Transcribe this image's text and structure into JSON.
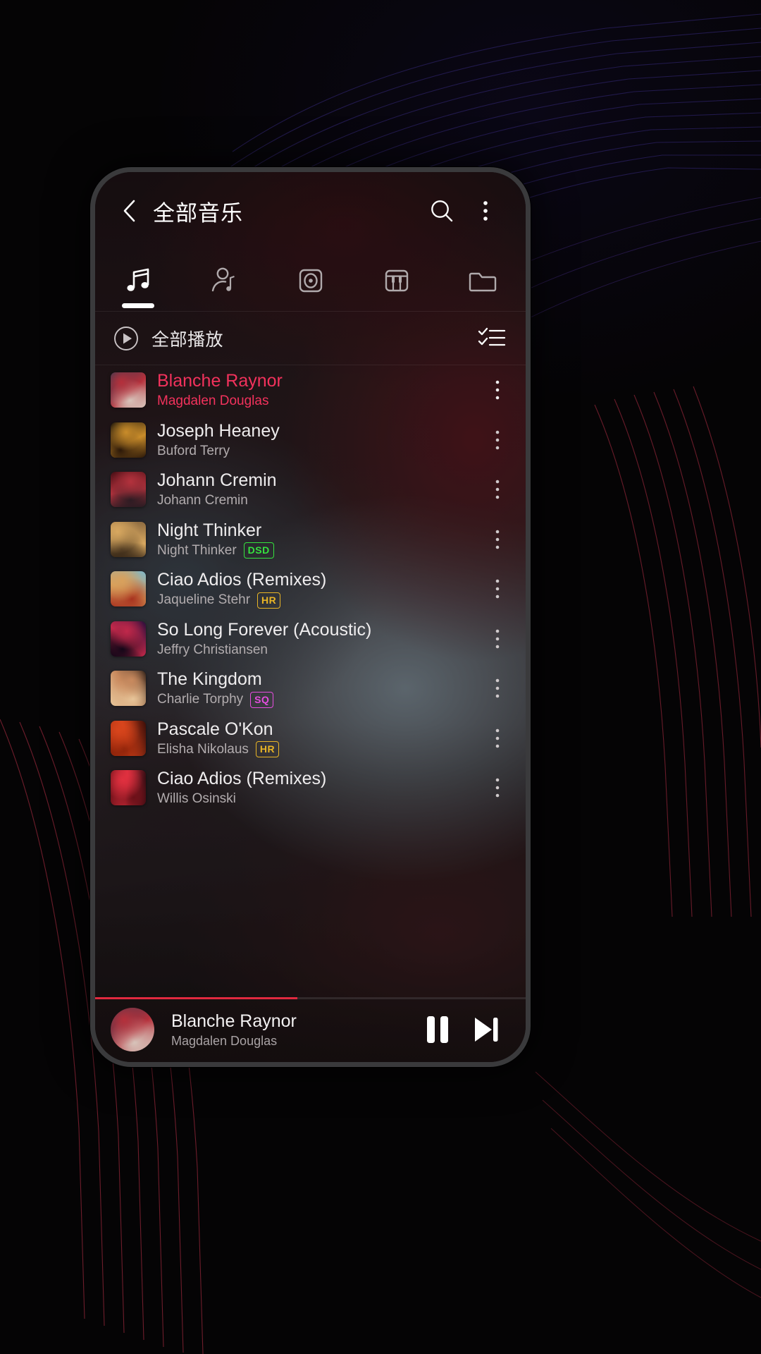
{
  "app": {
    "header": {
      "back_icon": "chevron-left-icon",
      "title": "全部音乐",
      "search_icon": "search-icon",
      "more_icon": "more-vertical-icon"
    },
    "tabs": [
      {
        "name": "songs",
        "icon": "music-note-icon",
        "active": true
      },
      {
        "name": "artists",
        "icon": "artist-icon",
        "active": false
      },
      {
        "name": "albums",
        "icon": "album-disc-icon",
        "active": false
      },
      {
        "name": "genres",
        "icon": "piano-keys-icon",
        "active": false
      },
      {
        "name": "folders",
        "icon": "folder-icon",
        "active": false
      }
    ],
    "play_all": {
      "icon": "play-circle-icon",
      "label": "全部播放",
      "list_icon": "checklist-icon"
    },
    "songs": [
      {
        "title": "Blanche Raynor",
        "artist": "Magdalen Douglas",
        "badge": "",
        "playing": true,
        "art": [
          "#1b3b52",
          "#b5303b",
          "#d8c7bd"
        ]
      },
      {
        "title": "Joseph Heaney",
        "artist": "Buford Terry",
        "badge": "",
        "playing": false,
        "art": [
          "#0a0807",
          "#c98c2a",
          "#2a1708"
        ]
      },
      {
        "title": "Johann Cremin",
        "artist": "Johann Cremin",
        "badge": "",
        "playing": false,
        "art": [
          "#4a0f16",
          "#b3323d",
          "#2a1b22"
        ]
      },
      {
        "title": "Night Thinker",
        "artist": "Night Thinker",
        "badge": "DSD",
        "playing": false,
        "art": [
          "#8c6a40",
          "#d8a860",
          "#3b2a18"
        ]
      },
      {
        "title": "Ciao Adios (Remixes)",
        "artist": "Jaqueline Stehr",
        "badge": "HR",
        "playing": false,
        "art": [
          "#7fb7c9",
          "#d9a05b",
          "#a8331f"
        ]
      },
      {
        "title": "So Long Forever (Acoustic)",
        "artist": "Jeffry Christiansen",
        "badge": "",
        "playing": false,
        "art": [
          "#2a0e3c",
          "#c0284a",
          "#120617"
        ]
      },
      {
        "title": "The Kingdom",
        "artist": "Charlie Torphy",
        "badge": "SQ",
        "playing": false,
        "art": [
          "#120d0c",
          "#c98a5e",
          "#e8c79b"
        ]
      },
      {
        "title": "Pascale O'Kon",
        "artist": "Elisha Nikolaus",
        "badge": "HR",
        "playing": false,
        "art": [
          "#3a0d08",
          "#d8451c",
          "#8c2209"
        ]
      },
      {
        "title": "Ciao Adios (Remixes)",
        "artist": "Willis Osinski",
        "badge": "",
        "playing": false,
        "art": [
          "#2a0a10",
          "#e0303f",
          "#6b1018"
        ]
      }
    ],
    "now_playing": {
      "title": "Blanche Raynor",
      "artist": "Magdalen Douglas",
      "pause_icon": "pause-icon",
      "next_icon": "skip-next-icon",
      "progress_percent": 47,
      "art": [
        "#1b3b52",
        "#b5303b",
        "#d8c7bd"
      ]
    },
    "colors": {
      "accent": "#f2325c",
      "progress": "#e0293f",
      "badge_dsd": "#35e23e",
      "badge_hr": "#e8b426",
      "badge_sq": "#e64de0",
      "text_primary": "#efedee",
      "text_secondary": "#b2acae"
    }
  }
}
